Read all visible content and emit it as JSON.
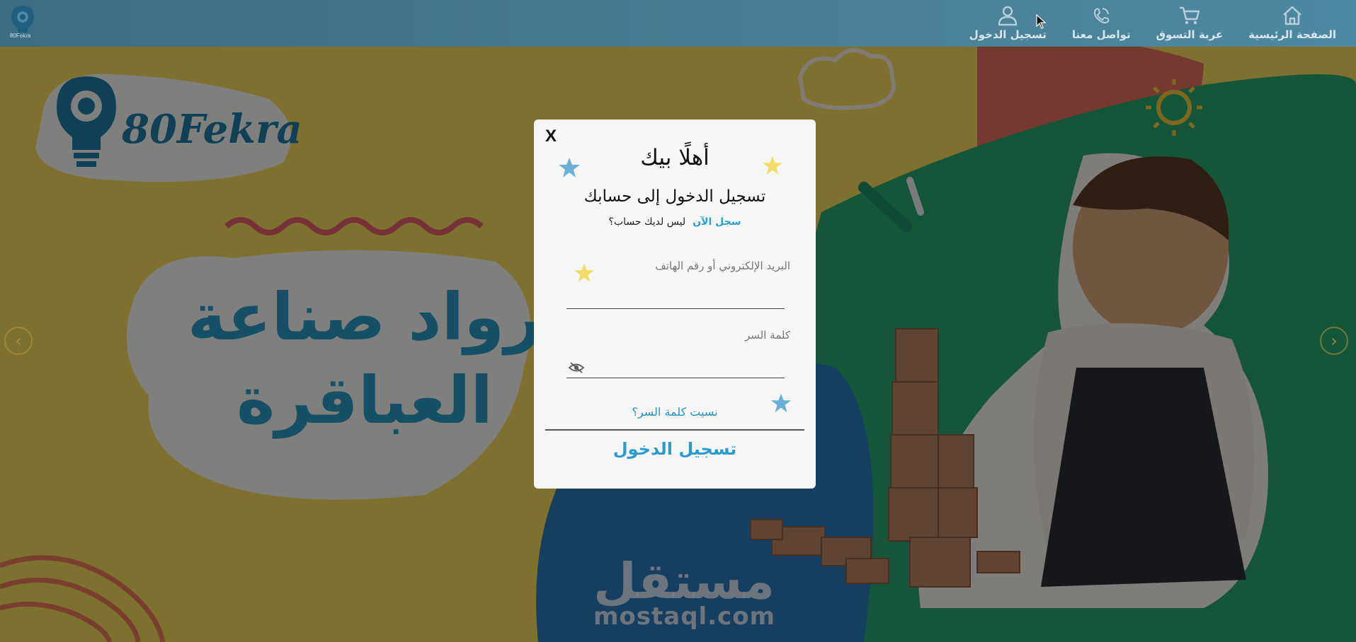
{
  "nav": {
    "logo_text": "80Fekra",
    "items": [
      {
        "label": "الصفحة الرئيسية",
        "icon": "home-icon"
      },
      {
        "label": "عربة التسوق",
        "icon": "cart-icon"
      },
      {
        "label": "تواصل معنا",
        "icon": "phone-icon"
      },
      {
        "label": "تسجيل الدخول",
        "icon": "user-icon"
      }
    ]
  },
  "hero": {
    "logo_text": "80Fekra",
    "headline_line1": "رواد صناعة",
    "headline_line2": "العباقرة",
    "watermark_ar": "مستقل",
    "watermark_en": "mostaql.com"
  },
  "modal": {
    "close_label": "X",
    "welcome": "أهلًا بيك",
    "subtitle": "تسجيل الدخول إلى حسابك",
    "no_account_text": "ليس لديك حساب؟",
    "signup_link": "سجل الآن",
    "email_label": "البريد الإلكتروني أو رقم الهاتف",
    "email_value": "",
    "password_label": "كلمة السر",
    "password_value": "",
    "forgot_password": "نسيت كلمة السر؟",
    "login_button": "تسجيل الدخول"
  },
  "colors": {
    "navbar": "#4a7e96",
    "accent": "#2a9ccc",
    "modal_bg": "#f6f6f6",
    "star_yellow": "#f3dd6a",
    "star_blue": "#6ab0d8"
  }
}
